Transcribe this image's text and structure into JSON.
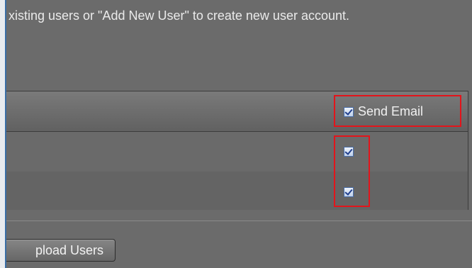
{
  "instructions": "xisting users or \"Add New User\" to create new user account.",
  "table": {
    "header": {
      "send_email_label": "Send Email",
      "send_email_checked": true
    },
    "rows": [
      {
        "send_email_checked": true
      },
      {
        "send_email_checked": true
      }
    ]
  },
  "buttons": {
    "upload_users_label": "pload Users"
  },
  "colors": {
    "highlight": "#e3141b",
    "checkbox_border": "#4a6ea8",
    "background": "#6b6b6b"
  }
}
